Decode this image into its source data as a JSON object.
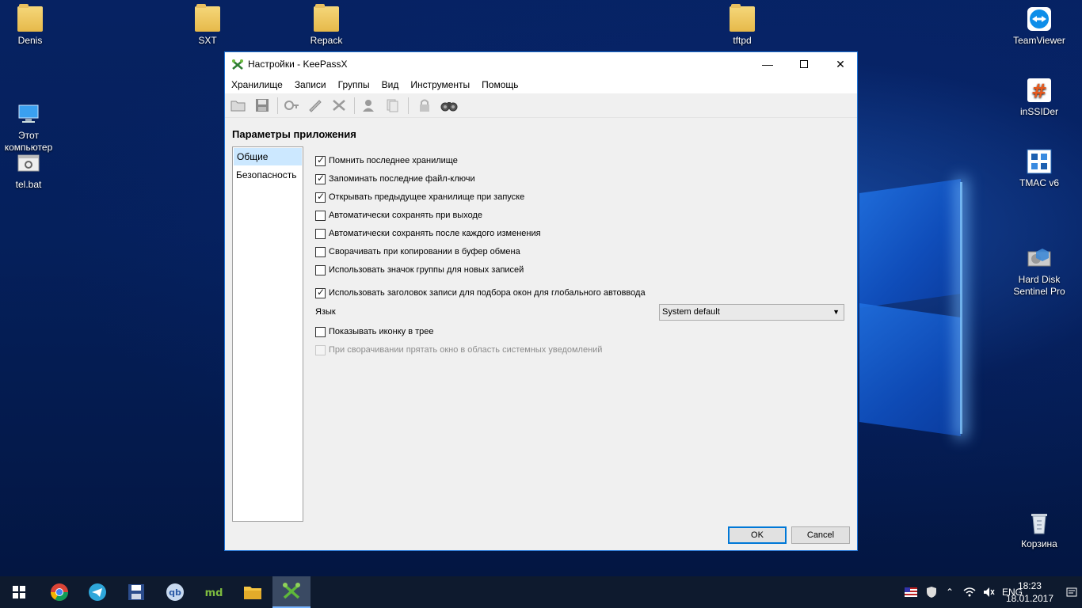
{
  "desktop": {
    "icons_left": [
      {
        "label": "Denis"
      },
      {
        "label": "SXT"
      },
      {
        "label": "Repack"
      },
      {
        "label": "tftpd"
      },
      {
        "label": "Этот\nкомпьютер"
      },
      {
        "label": "tel.bat"
      }
    ],
    "icons_right": [
      {
        "label": "TeamViewer"
      },
      {
        "label": "inSSIDer"
      },
      {
        "label": "TMAC v6"
      },
      {
        "label": "Hard Disk\nSentinel Pro"
      },
      {
        "label": "Корзина"
      }
    ]
  },
  "window": {
    "title": "Настройки - KeePassX",
    "menu": [
      "Хранилище",
      "Записи",
      "Группы",
      "Вид",
      "Инструменты",
      "Помощь"
    ],
    "toolbar_icons": [
      "open-database-icon",
      "save-database-icon",
      "add-entry-icon",
      "edit-entry-icon",
      "delete-entry-icon",
      "copy-username-icon",
      "copy-password-icon",
      "lock-icon",
      "search-icon"
    ],
    "heading": "Параметры приложения",
    "sidebar": [
      "Общие",
      "Безопасность"
    ],
    "options": [
      {
        "label": "Помнить последнее хранилище",
        "checked": true
      },
      {
        "label": "Запоминать последние файл-ключи",
        "checked": true
      },
      {
        "label": "Открывать предыдущее хранилище при запуске",
        "checked": true
      },
      {
        "label": "Автоматически сохранять при выходе",
        "checked": false
      },
      {
        "label": "Автоматически сохранять после каждого изменения",
        "checked": false
      },
      {
        "label": "Сворачивать при копировании в буфер обмена",
        "checked": false
      },
      {
        "label": "Использовать значок группы для новых записей",
        "checked": false
      },
      {
        "label": "Использовать заголовок записи для подбора окон для глобального автоввода",
        "checked": true
      }
    ],
    "language_label": "Язык",
    "language_value": "System default",
    "options2": [
      {
        "label": "Показывать иконку в трее",
        "checked": false
      },
      {
        "label": "При сворачивании прятать окно в область системных уведомлений",
        "checked": false,
        "disabled": true
      }
    ],
    "ok_label": "OK",
    "cancel_label": "Cancel"
  },
  "taskbar": {
    "apps": [
      "start-icon",
      "chrome-icon",
      "telegram-icon",
      "save-icon",
      "qbittorrent-icon",
      "markdown-icon",
      "explorer-icon",
      "keepassx-icon"
    ],
    "lang": "ENG",
    "time": "18:23",
    "date": "18.01.2017"
  }
}
